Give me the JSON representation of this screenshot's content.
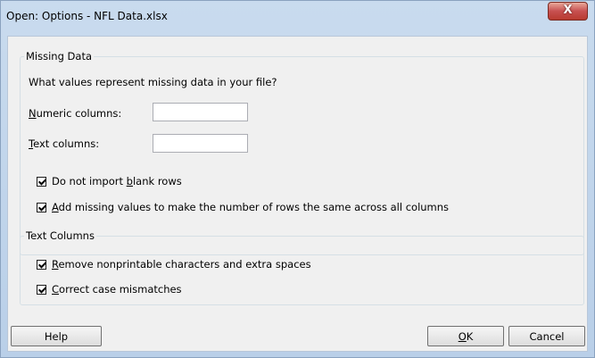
{
  "window": {
    "title": "Open: Options - NFL Data.xlsx",
    "close_glyph": "X"
  },
  "missing_data": {
    "legend": "Missing Data",
    "prompt": "What values represent missing data in your file?",
    "numeric": {
      "mnemonic": "N",
      "label_rest": "umeric columns:",
      "value": ""
    },
    "text": {
      "mnemonic": "T",
      "label_rest": "ext columns:",
      "value": ""
    },
    "no_blank_rows": {
      "before": "Do not import ",
      "mnemonic": "b",
      "after": "lank rows",
      "checked": true
    },
    "add_missing": {
      "before": "",
      "mnemonic": "A",
      "after": "dd missing values to make the number of rows the same across all columns",
      "checked": true
    }
  },
  "text_columns": {
    "legend": "Text Columns",
    "remove_nonprintable": {
      "mnemonic": "R",
      "after": "emove nonprintable characters and extra spaces",
      "checked": true
    },
    "correct_case": {
      "mnemonic": "C",
      "after": "orrect case mismatches",
      "checked": true
    }
  },
  "buttons": {
    "help": "Help",
    "ok_mnemonic": "O",
    "ok_rest": "K",
    "cancel": "Cancel"
  },
  "colors": {
    "close_button": "#c75050",
    "title_bar": "#c9dbee"
  },
  "icons": [
    "close-icon",
    "checkmark-icon"
  ]
}
